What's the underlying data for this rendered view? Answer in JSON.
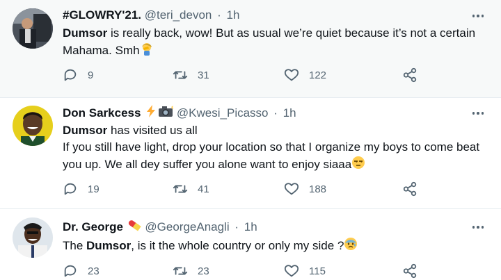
{
  "tweets": [
    {
      "display_name": "#GLOWRY'21.",
      "handle": "@teri_devon",
      "time": "1h",
      "text_parts": [
        "Dumsor",
        " is really back, wow! But as usual we’re quiet because it’s not a certain Mahama. Smh"
      ],
      "trailing_emoji": "person-facepalming",
      "replies": "9",
      "retweets": "31",
      "likes": "122"
    },
    {
      "display_name": "Don Sarkcess",
      "name_emojis": [
        "high-voltage",
        "camera-with-flash"
      ],
      "handle": "@Kwesi_Picasso",
      "time": "1h",
      "text_line1_parts": [
        "Dumsor",
        " has visited us all"
      ],
      "text_line2": "If you still have light, drop your location so that I organize my boys to come beat you up. We all dey suffer you alone want to enjoy siaaa",
      "trailing_emoji": "unamused-face",
      "replies": "19",
      "retweets": "41",
      "likes": "188"
    },
    {
      "display_name": "Dr. George",
      "name_emojis": [
        "pill"
      ],
      "handle": "@GeorgeAnagli",
      "time": "1h",
      "text_parts": [
        "The ",
        "Dumsor",
        ", is it the whole country or only my side ?"
      ],
      "trailing_emoji": "anxious-face-with-sweat",
      "replies": "23",
      "retweets": "23",
      "likes": "115"
    }
  ],
  "separator": "·"
}
